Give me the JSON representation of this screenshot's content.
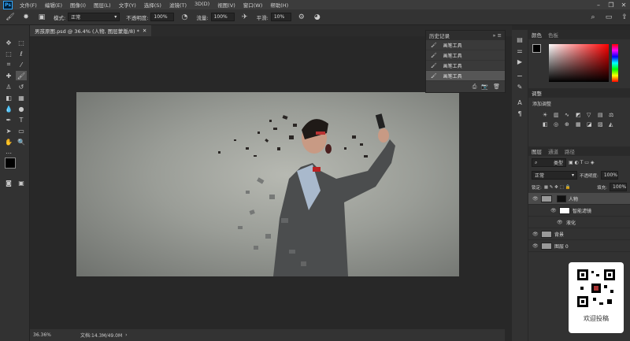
{
  "app": {
    "logo": "Ps"
  },
  "menu": [
    "文件(F)",
    "编辑(E)",
    "图像(I)",
    "图层(L)",
    "文字(Y)",
    "选择(S)",
    "滤镜(T)",
    "3D(D)",
    "视图(V)",
    "窗口(W)",
    "帮助(H)"
  ],
  "options": {
    "mode_label": "模式:",
    "mode_value": "正常",
    "opacity_label": "不透明度:",
    "opacity_value": "100%",
    "flow_label": "流量:",
    "flow_value": "100%",
    "smooth_label": "平滑:",
    "smooth_value": "10%"
  },
  "document": {
    "tab_title": "男孩原图.psd @ 36.4% (人物, 图层蒙版/8) *"
  },
  "status": {
    "zoom": "36.36%",
    "doc_size": "文档:14.3M/49.0M"
  },
  "history": {
    "title": "历史记录",
    "items": [
      "画笔工具",
      "画笔工具",
      "画笔工具",
      "画笔工具"
    ]
  },
  "color_panel": {
    "tabs": [
      "颜色",
      "色板"
    ]
  },
  "adjust_panel": {
    "title": "调整",
    "add_label": "添加调整"
  },
  "layers_panel": {
    "tabs": [
      "图层",
      "通道",
      "路径"
    ],
    "kind_label": "类型",
    "blend_mode": "正常",
    "opacity_label": "不透明度:",
    "opacity_value": "100%",
    "lock_label": "锁定:",
    "fill_label": "填充:",
    "fill_value": "100%",
    "layers": [
      {
        "name": "人物"
      },
      {
        "name": "智能滤镜"
      },
      {
        "name": "液化"
      },
      {
        "name": "背景"
      },
      {
        "name": "图层 0"
      }
    ]
  },
  "qr": {
    "caption": "欢迎投稿"
  },
  "colors": {
    "accent": "#31a8ff",
    "hue_top": "#ff0000",
    "foreground": "#000000",
    "background": "#ffffff"
  }
}
